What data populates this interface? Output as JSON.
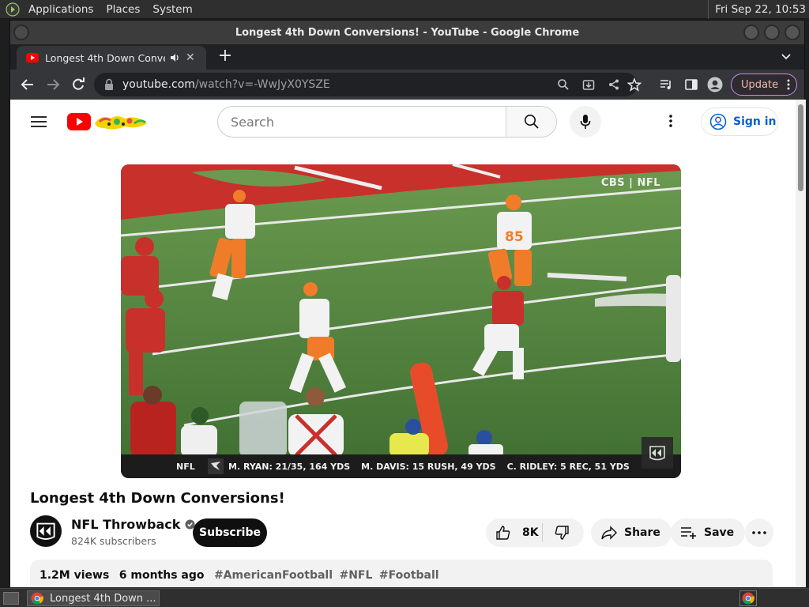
{
  "top_panel": {
    "menus": [
      "Applications",
      "Places",
      "System"
    ],
    "clock": "Fri Sep 22, 10:53"
  },
  "window": {
    "title": "Longest 4th Down Conversions! - YouTube - Google Chrome"
  },
  "tab": {
    "title": "Longest 4th Down Conversions!"
  },
  "toolbar": {
    "url_host": "youtube.com",
    "url_path": "/watch?v=-WwJyX0YSZE",
    "update_label": "Update"
  },
  "youtube": {
    "search_placeholder": "Search",
    "signin_label": "Sign in",
    "video": {
      "watermark": "CBS | NFL",
      "score_bar": {
        "league": "NFL",
        "stats": [
          "M. RYAN: 21/35, 164 YDS",
          "M. DAVIS: 15 RUSH, 49 YDS",
          "C. RIDLEY: 5 REC, 51 YDS"
        ]
      }
    },
    "title": "Longest 4th Down Conversions!",
    "channel": {
      "name": "NFL Throwback",
      "subscribers": "824K subscribers",
      "subscribe_label": "Subscribe"
    },
    "actions": {
      "likes": "8K",
      "share_label": "Share",
      "save_label": "Save"
    },
    "description": {
      "views": "1.2M views",
      "age": "6 months ago",
      "tags": [
        "#AmericanFootball",
        "#NFL",
        "#Football"
      ]
    }
  },
  "taskbar": {
    "task_title": "Longest 4th Down ..."
  },
  "colors": {
    "youtube_red": "#ff0000",
    "signin_blue": "#065fd4",
    "chrome_dark": "#35363a"
  }
}
